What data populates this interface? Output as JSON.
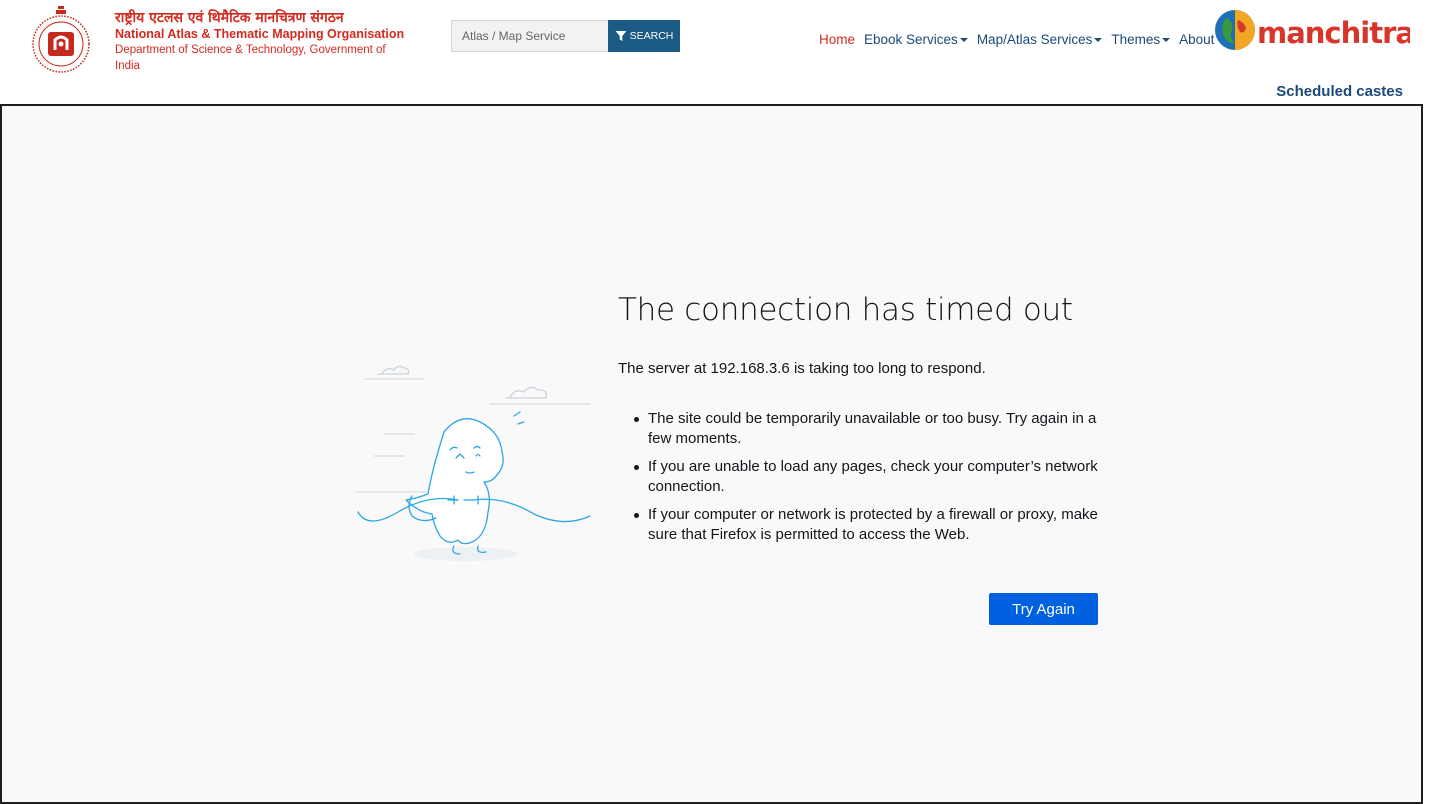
{
  "header": {
    "org_hindi": "राष्ट्रीय एटलस एवं थिमैटिक मानचित्रण संगठन",
    "org_english": "National Atlas & Thematic Mapping Organisation",
    "org_department": "Department of Science & Technology, Government of India",
    "logo_text": "manchitran"
  },
  "search": {
    "placeholder": "Atlas / Map Service",
    "button_label": "SEARCH"
  },
  "nav": {
    "items": [
      {
        "label": "Home",
        "active": true
      },
      {
        "label": "Ebook Services",
        "dropdown": true
      },
      {
        "label": "Map/Atlas Services",
        "dropdown": true
      },
      {
        "label": "Themes",
        "dropdown": true
      },
      {
        "label": "About Us"
      }
    ]
  },
  "page_heading": "Scheduled castes",
  "error": {
    "title": "The connection has timed out",
    "description": "The server at 192.168.3.6 is taking too long to respond.",
    "suggestions": [
      "The site could be temporarily unavailable or too busy. Try again in a few moments.",
      "If you are unable to load any pages, check your computer’s network connection.",
      "If your computer or network is protected by a firewall or proxy, make sure that Firefox is permitted to access the Web."
    ],
    "button_label": "Try Again"
  },
  "colors": {
    "brand_red": "#d42a1f",
    "nav_blue": "#1b4a7a",
    "search_button": "#1b5a82",
    "primary_button": "#0061e0",
    "page_background": "#f9f9fa",
    "illustration": "#2ea7e0"
  },
  "icons": {
    "emblem": "natmo-emblem-icon",
    "search": "filter-funnel-icon",
    "logo_globe": "globe-icon",
    "illustration": "unplugged-dino-illustration"
  }
}
